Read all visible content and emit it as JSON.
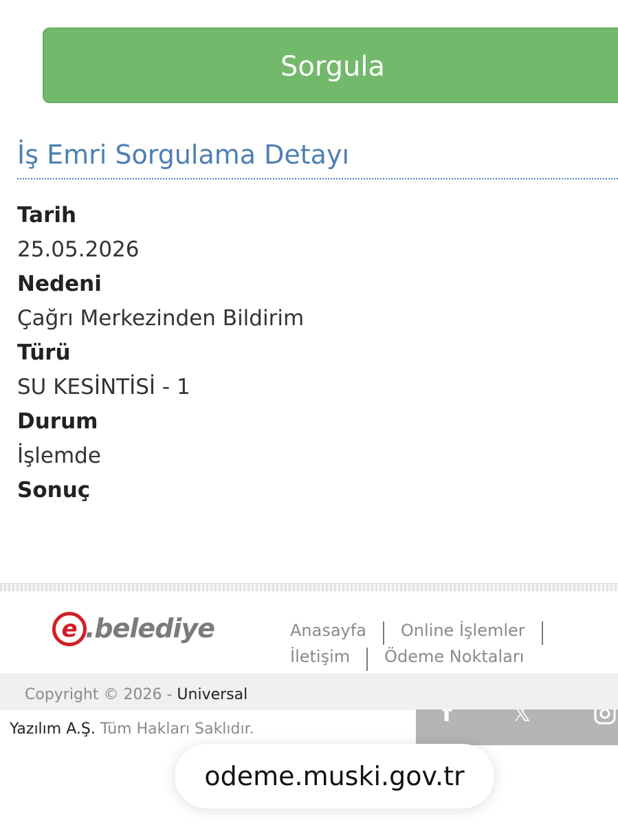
{
  "query_button": {
    "label": "Sorgula"
  },
  "section": {
    "title": "İş Emri Sorgulama Detayı"
  },
  "details": [
    {
      "label": "Tarih",
      "value": "25.05.2026"
    },
    {
      "label": "Nedeni",
      "value": "Çağrı Merkezinden Bildirim"
    },
    {
      "label": "Türü",
      "value": "SU KESİNTİSİ - 1"
    },
    {
      "label": "Durum",
      "value": "İşlemde"
    },
    {
      "label": "Sonuç",
      "value": ""
    }
  ],
  "footer": {
    "logo_letter": "e",
    "logo_text": ".belediye",
    "links": [
      "Anasayfa",
      "Online İşlemler",
      "İletişim",
      "Ödeme Noktaları"
    ],
    "copyright_prefix": "Copyright © 2026 - ",
    "copyright_brand": "Universal",
    "company": "Yazılım A.Ş.",
    "rights": " Tüm Hakları Saklıdır.",
    "social_icons": [
      "facebook-icon",
      "x-icon",
      "instagram-icon"
    ]
  },
  "browser": {
    "url": "odeme.muski.gov.tr"
  },
  "colors": {
    "button_green": "#73b96b",
    "title_blue": "#4d7fb3",
    "logo_red": "#cf2027",
    "social_gray": "#b5b5b5"
  }
}
